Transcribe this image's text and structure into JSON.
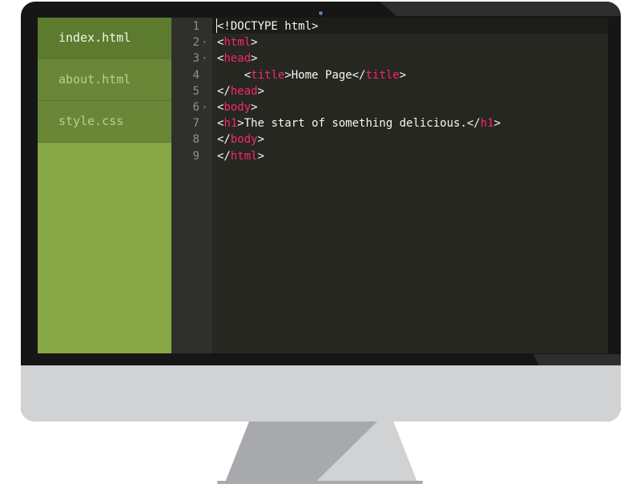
{
  "sidebar": {
    "files": [
      {
        "label": "index.html",
        "active": true
      },
      {
        "label": "about.html",
        "active": false
      },
      {
        "label": "style.css",
        "active": false
      }
    ]
  },
  "editor": {
    "line_numbers": [
      "1",
      "2",
      "3",
      "4",
      "5",
      "6",
      "7",
      "8",
      "9"
    ],
    "foldable_lines": [
      2,
      3,
      6
    ],
    "lines": [
      [
        {
          "t": "<!DOCTYPE html>",
          "c": "text"
        }
      ],
      [
        {
          "t": "<",
          "c": "text"
        },
        {
          "t": "html",
          "c": "tag"
        },
        {
          "t": ">",
          "c": "text"
        }
      ],
      [
        {
          "t": "<",
          "c": "text"
        },
        {
          "t": "head",
          "c": "tag"
        },
        {
          "t": ">",
          "c": "text"
        }
      ],
      [
        {
          "t": "    <",
          "c": "text"
        },
        {
          "t": "title",
          "c": "tag"
        },
        {
          "t": ">Home Page</",
          "c": "text"
        },
        {
          "t": "title",
          "c": "tag"
        },
        {
          "t": ">",
          "c": "text"
        }
      ],
      [
        {
          "t": "</",
          "c": "text"
        },
        {
          "t": "head",
          "c": "tag"
        },
        {
          "t": ">",
          "c": "text"
        }
      ],
      [
        {
          "t": "<",
          "c": "text"
        },
        {
          "t": "body",
          "c": "tag"
        },
        {
          "t": ">",
          "c": "text"
        }
      ],
      [
        {
          "t": "<",
          "c": "text"
        },
        {
          "t": "h1",
          "c": "tag"
        },
        {
          "t": ">The start of something delicious.</",
          "c": "text"
        },
        {
          "t": "h1",
          "c": "tag"
        },
        {
          "t": ">",
          "c": "text"
        }
      ],
      [
        {
          "t": "</",
          "c": "text"
        },
        {
          "t": "body",
          "c": "tag"
        },
        {
          "t": ">",
          "c": "text"
        }
      ],
      [
        {
          "t": "</",
          "c": "text"
        },
        {
          "t": "html",
          "c": "tag"
        },
        {
          "t": ">",
          "c": "text"
        }
      ]
    ]
  },
  "colors": {
    "tag": "#f92672",
    "text": "#f8f8f2",
    "sidebar_green": "#86a744"
  }
}
